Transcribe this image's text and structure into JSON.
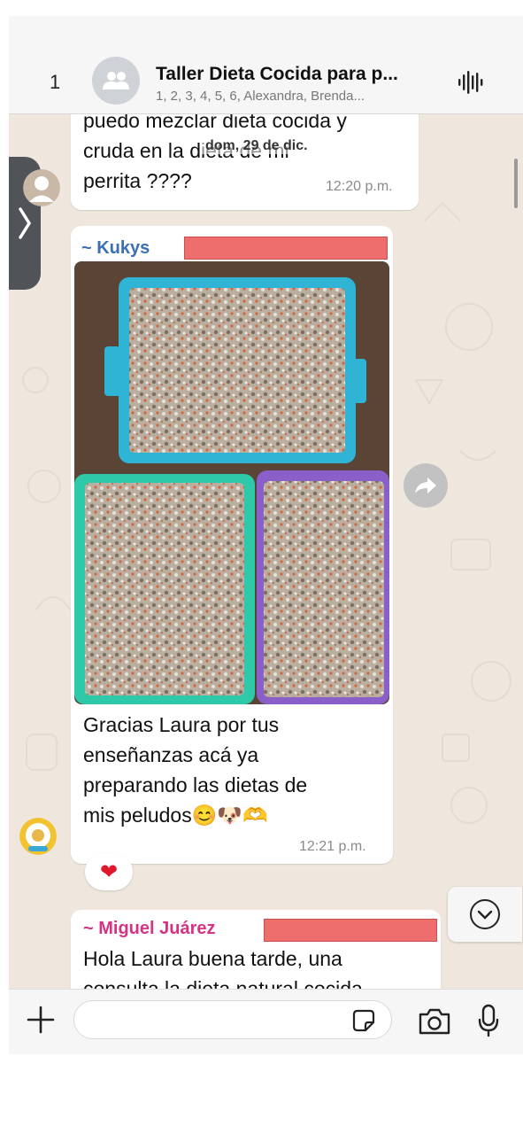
{
  "header": {
    "back_count": "1",
    "title": "Taller Dieta Cocida para p...",
    "subtitle": "1, 2, 3, 4, 5, 6, Alexandra, Brenda..."
  },
  "date_separator": "dom, 29 de dic.",
  "messages": [
    {
      "lines": [
        "puedo mezclar dieta cocida y",
        "cruda en la dieta de mi",
        "perrita ????"
      ],
      "time": "12:20 p.m."
    },
    {
      "sender": "~ Kukys",
      "sender_color": "#3b6fb6",
      "lines": [
        "Gracias Laura por tus",
        "enseñanzas acá ya",
        "preparando las dietas de",
        "mis peludos😊🐶🫶"
      ],
      "time": "12:21 p.m.",
      "reaction": "❤"
    },
    {
      "sender": "~ Miguel Juárez",
      "sender_color": "#d63384",
      "lines": [
        "Hola Laura buena tarde, una",
        "consulta la dieta natural cocida"
      ]
    }
  ],
  "colors": {
    "chat_background": "#efe7dd",
    "bubble": "#ffffff",
    "redaction": "#ee6e6e"
  },
  "icons": {
    "back": "chevron-right-icon",
    "group": "group-avatar-icon",
    "voice": "voice-waveform-icon",
    "forward": "forward-icon",
    "scroll_down": "chevron-down-icon",
    "plus": "plus-icon",
    "sticker": "sticker-icon",
    "camera": "camera-icon",
    "mic": "microphone-icon"
  }
}
